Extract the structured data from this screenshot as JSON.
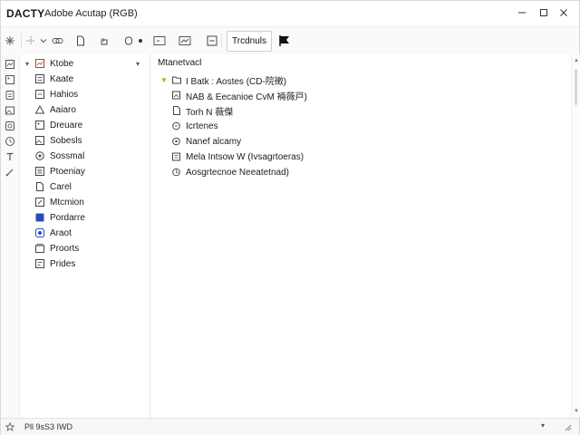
{
  "window": {
    "logo": "DACTY",
    "title": "Adobe Acutap (RGB)",
    "minimize_icon": "minimize-icon",
    "maximize_icon": "maximize-icon",
    "close_icon": "close-icon"
  },
  "toolbar": {
    "icons": [
      "sparkle-icon",
      "move-icon",
      "chevron-down-icon",
      "link-icon",
      "document-icon",
      "rotate-icon",
      "circle-icon",
      "dot-icon",
      "frame-icon",
      "gradient-icon",
      "minus-box-icon"
    ],
    "active_label": "Trcdnuls",
    "flag_icon": "flag-icon"
  },
  "rail": {
    "icons": [
      "layers-icon",
      "image-icon",
      "stack-icon",
      "picture-icon",
      "adjust-icon",
      "clock-icon",
      "type-icon",
      "brush-icon"
    ]
  },
  "nav": {
    "items": [
      {
        "label": "Ktobe",
        "icon": "layers-icon",
        "expand": "▾",
        "caret": "▾"
      },
      {
        "label": "Kaate",
        "icon": "layers-icon"
      },
      {
        "label": "Hahios",
        "icon": "layers-icon"
      },
      {
        "label": "Aaiaro",
        "icon": "warning-icon"
      },
      {
        "label": "Dreuare",
        "icon": "image-icon"
      },
      {
        "label": "Sobesls",
        "icon": "image-icon"
      },
      {
        "label": "Sossmal",
        "icon": "shield-icon"
      },
      {
        "label": "Ptoeniay",
        "icon": "layers-icon"
      },
      {
        "label": "Carel",
        "icon": "document-icon"
      },
      {
        "label": "Mtcmion",
        "icon": "edit-icon"
      },
      {
        "label": "Pordarre",
        "icon": "square-blue-icon"
      },
      {
        "label": "Araot",
        "icon": "shield-blue-icon"
      },
      {
        "label": "Proorts",
        "icon": "layers-icon"
      },
      {
        "label": "Prides",
        "icon": "image-icon"
      }
    ]
  },
  "main": {
    "header": "Mtanetvacl",
    "tree": [
      {
        "label": "I Batk : Aostes (CD-院徵)",
        "icon": "folder-icon",
        "expanded": true
      },
      {
        "label": "NAB & Eecanioe CvM 裲薇戸)",
        "icon": "layer-icon"
      },
      {
        "label": "Torh N 薇傑",
        "icon": "layer-icon"
      },
      {
        "label": "Icrtenes",
        "icon": "layer-icon"
      },
      {
        "label": "Nanef alcamy",
        "icon": "layer-icon"
      },
      {
        "label": "Mela Intsow W (Ivsagrtoeras)",
        "icon": "layer-icon"
      },
      {
        "label": "Aosgrtecnoe Neeatetnad)",
        "icon": "layer-icon"
      }
    ]
  },
  "statusbar": {
    "icon": "star-icon",
    "text": "Pll 9sS3 IWD",
    "caret": "▾",
    "grip_icon": "resize-grip-icon"
  }
}
